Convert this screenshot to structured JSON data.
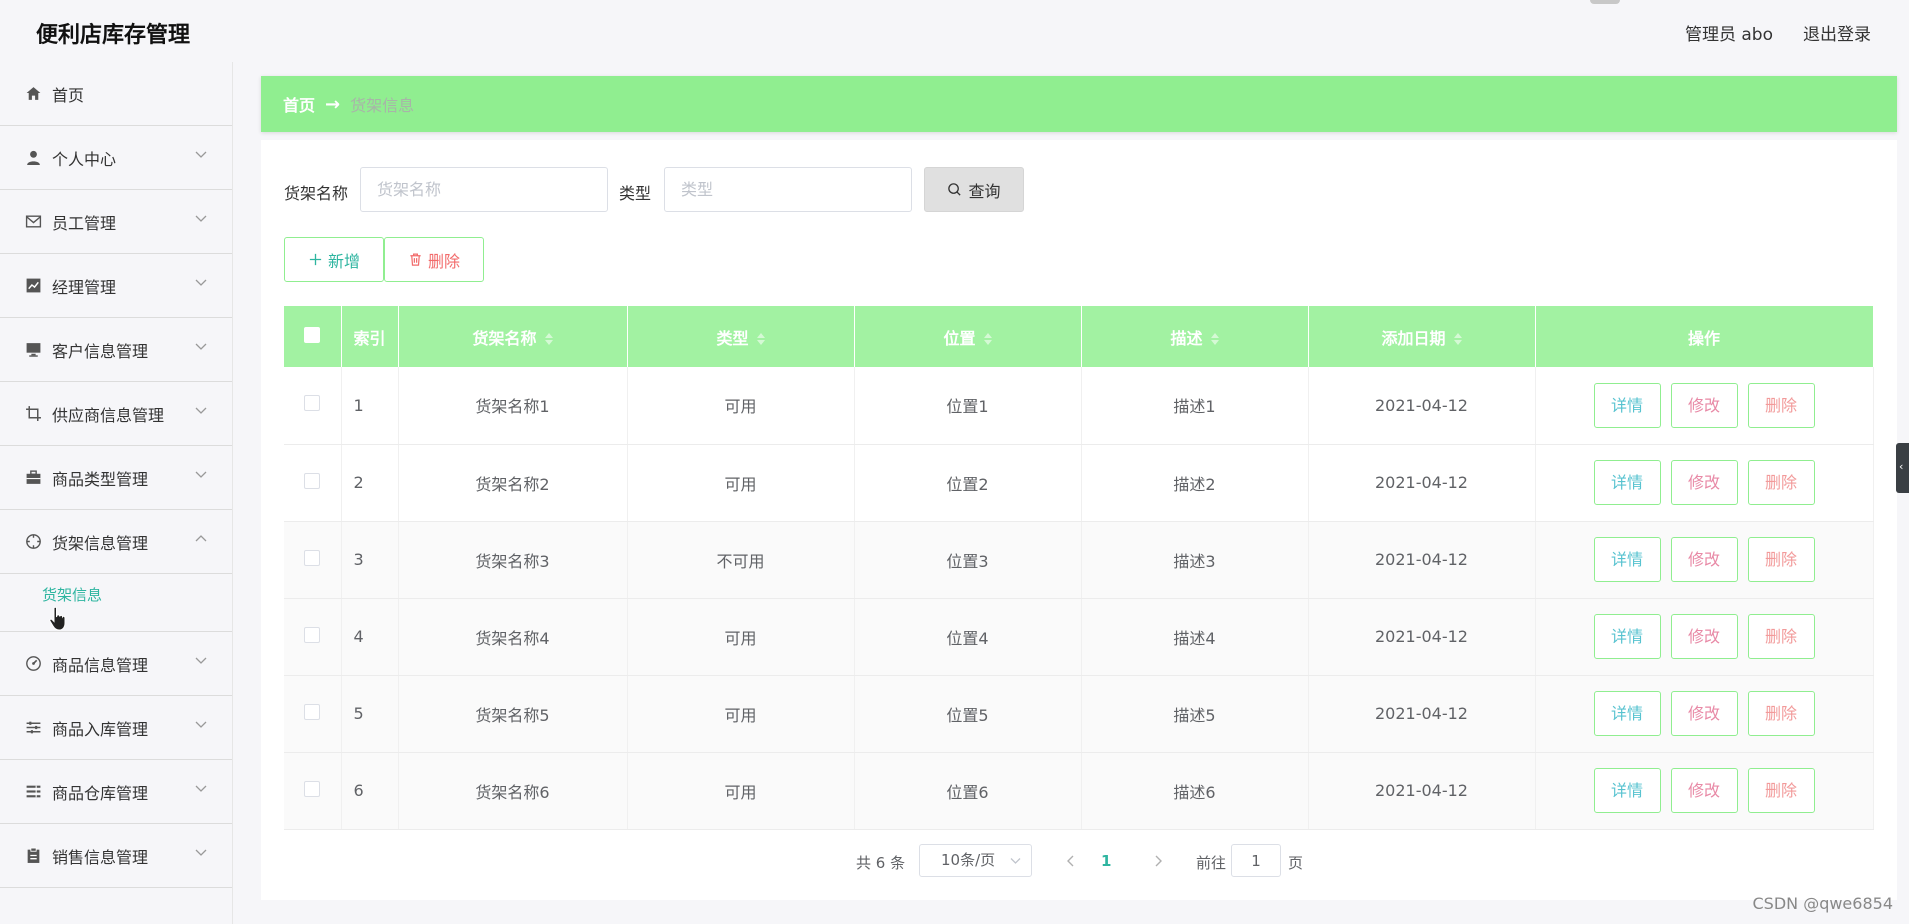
{
  "header": {
    "app_title": "便利店库存管理",
    "user_label": "管理员 abo",
    "logout_label": "退出登录"
  },
  "sidebar": {
    "items": [
      {
        "label": "首页",
        "icon": "home-icon"
      },
      {
        "label": "个人中心",
        "icon": "user-icon"
      },
      {
        "label": "员工管理",
        "icon": "mail-icon"
      },
      {
        "label": "经理管理",
        "icon": "chart-icon"
      },
      {
        "label": "客户信息管理",
        "icon": "monitor-icon"
      },
      {
        "label": "供应商信息管理",
        "icon": "crop-icon"
      },
      {
        "label": "商品类型管理",
        "icon": "briefcase-icon"
      },
      {
        "label": "货架信息管理",
        "icon": "compass-icon"
      },
      {
        "label": "商品信息管理",
        "icon": "gauge-icon"
      },
      {
        "label": "商品入库管理",
        "icon": "sliders-icon"
      },
      {
        "label": "商品仓库管理",
        "icon": "list-icon"
      },
      {
        "label": "销售信息管理",
        "icon": "clipboard-icon"
      }
    ],
    "active_sub_item": "货架信息"
  },
  "breadcrumb": {
    "home": "首页",
    "arrow": "→",
    "current": "货架信息"
  },
  "search": {
    "name_label": "货架名称",
    "name_placeholder": "货架名称",
    "type_label": "类型",
    "type_placeholder": "类型",
    "query_label": "查询"
  },
  "actions": {
    "add_label": "新增",
    "delete_label": "删除"
  },
  "table": {
    "columns": [
      "索引",
      "货架名称",
      "类型",
      "位置",
      "描述",
      "添加日期",
      "操作"
    ],
    "rows": [
      {
        "index": "1",
        "name": "货架名称1",
        "type": "可用",
        "location": "位置1",
        "desc": "描述1",
        "date": "2021-04-12"
      },
      {
        "index": "2",
        "name": "货架名称2",
        "type": "可用",
        "location": "位置2",
        "desc": "描述2",
        "date": "2021-04-12"
      },
      {
        "index": "3",
        "name": "货架名称3",
        "type": "不可用",
        "location": "位置3",
        "desc": "描述3",
        "date": "2021-04-12"
      },
      {
        "index": "4",
        "name": "货架名称4",
        "type": "可用",
        "location": "位置4",
        "desc": "描述4",
        "date": "2021-04-12"
      },
      {
        "index": "5",
        "name": "货架名称5",
        "type": "可用",
        "location": "位置5",
        "desc": "描述5",
        "date": "2021-04-12"
      },
      {
        "index": "6",
        "name": "货架名称6",
        "type": "可用",
        "location": "位置6",
        "desc": "描述6",
        "date": "2021-04-12"
      }
    ],
    "op_detail": "详情",
    "op_edit": "修改",
    "op_delete": "删除"
  },
  "pagination": {
    "total": "共 6 条",
    "page_size": "10条/页",
    "current_page": "1",
    "goto_label": "前往",
    "goto_value": "1",
    "page_suffix": "页"
  },
  "watermark": "CSDN @qwe6854",
  "colors": {
    "accent_green": "#90ee90",
    "table_header": "#a2f2a2",
    "link_teal": "#2eb5a0",
    "danger": "#f26b6b"
  }
}
